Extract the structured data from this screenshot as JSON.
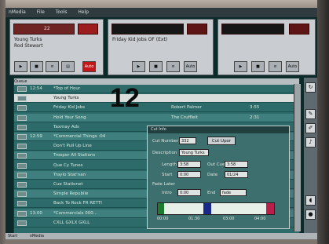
{
  "menu": [
    "nMedia",
    "File",
    "Tools",
    "Help"
  ],
  "decks": [
    {
      "title1": "Young Turks",
      "title2": "Rod Stewart",
      "counter": "22"
    },
    {
      "title1": "Friday Kid Jobs OF (Ext)",
      "title2": "",
      "counter": ""
    },
    {
      "title1": "",
      "title2": "",
      "counter": ""
    }
  ],
  "deck_buttons": [
    "Auto",
    "Auto",
    "Auto"
  ],
  "big_number": "12",
  "list_header": "Queue   ",
  "rows": [
    {
      "time": "12:54",
      "title": "*Top of Hour",
      "artist": "",
      "len": ""
    },
    {
      "time": "",
      "title": "Young Turks",
      "artist": "",
      "len": ""
    },
    {
      "time": "",
      "title": "Friday Kid Jobs",
      "artist": "Robert Palmer",
      "len": "3:55"
    },
    {
      "time": "",
      "title": "Hold Your Song",
      "artist": "The Cruffleit",
      "len": "2:31"
    },
    {
      "time": "",
      "title": "Taxmay Ads",
      "artist": "",
      "len": ""
    },
    {
      "time": "12:59",
      "title": "*Commercial Things :04",
      "artist": "",
      "len": ""
    },
    {
      "time": "",
      "title": "Don't Pull Up Line",
      "artist": "",
      "len": ""
    },
    {
      "time": "",
      "title": "Trooper All Stations",
      "artist": "",
      "len": ""
    },
    {
      "time": "",
      "title": "Que Cy Tunes",
      "artist": "",
      "len": ""
    },
    {
      "time": "",
      "title": "Traylo Stat'nan",
      "artist": "",
      "len": ""
    },
    {
      "time": "",
      "title": "Cue Stationet",
      "artist": "",
      "len": ""
    },
    {
      "time": "",
      "title": "Simple Republie",
      "artist": "",
      "len": ""
    },
    {
      "time": "",
      "title": "Back To Rock FR RETTI",
      "artist": "",
      "len": ""
    },
    {
      "time": "13:00",
      "title": "*Commercials 000...",
      "artist": "",
      "len": ""
    },
    {
      "time": "",
      "title": "CXLL GXLX GXLL",
      "artist": "",
      "len": ""
    }
  ],
  "dialog": {
    "title": "Cut Info",
    "cut_number_label": "Cut Number",
    "cut_number_value": "332",
    "cut_up_button": "Cut Upor",
    "description_label": "Description",
    "description_value": "Young Turks",
    "length_label": "Length",
    "length_value": "3:58",
    "start_label": "Start",
    "start_value": "0:00",
    "out_label": "Out Cue",
    "out_value": "3:58",
    "date_label": "Date",
    "date_value": "01/24",
    "intro_label": "Intro",
    "intro_value": "0:00",
    "fade_label": "Fade Later",
    "fade_value": "0:00",
    "end_label": "End",
    "end_value": "fade",
    "wave_labels": [
      "00:00",
      "01:30",
      "03:00",
      "04:00"
    ]
  },
  "taskbar": {
    "start": "Start",
    "item": "nMedia"
  },
  "colors": {
    "accent_red": "#c2181a",
    "list_bg": "#2d6b6a",
    "screen_bg": "#0d2a2a"
  }
}
